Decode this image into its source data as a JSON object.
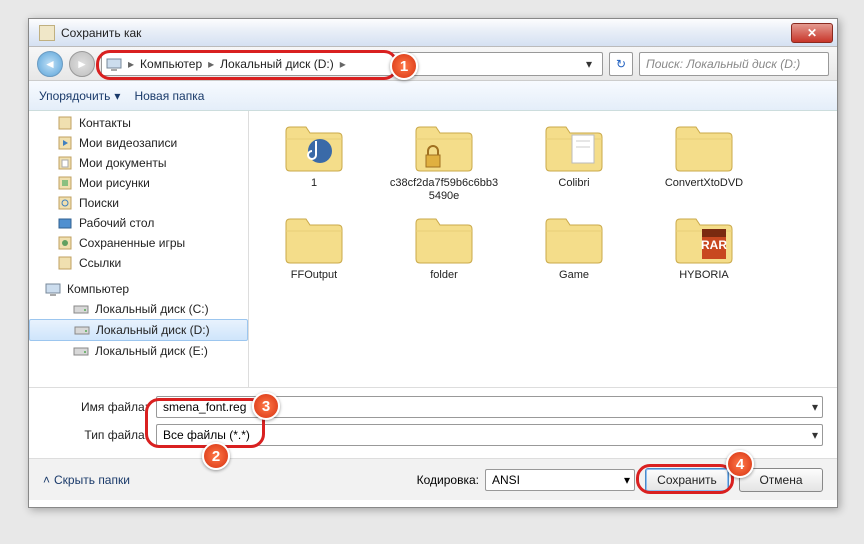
{
  "title": "Сохранить как",
  "breadcrumb": {
    "p1": "Компьютер",
    "p2": "Локальный диск (D:)"
  },
  "search_placeholder": "Поиск: Локальный диск (D:)",
  "toolbar": {
    "organize": "Упорядочить",
    "newfolder": "Новая папка"
  },
  "sidebar": {
    "items": [
      {
        "label": "Контакты"
      },
      {
        "label": "Мои видеозаписи"
      },
      {
        "label": "Мои документы"
      },
      {
        "label": "Мои рисунки"
      },
      {
        "label": "Поиски"
      },
      {
        "label": "Рабочий стол"
      },
      {
        "label": "Сохраненные игры"
      },
      {
        "label": "Ссылки"
      }
    ],
    "computer": "Компьютер",
    "drives": [
      {
        "label": "Локальный диск (C:)"
      },
      {
        "label": "Локальный диск (D:)"
      },
      {
        "label": "Локальный диск (E:)"
      }
    ]
  },
  "files": [
    {
      "label": "1",
      "variant": "music"
    },
    {
      "label": "c38cf2da7f59b6c6bb35490e",
      "variant": "lock"
    },
    {
      "label": "Colibri",
      "variant": "doc"
    },
    {
      "label": "ConvertXtoDVD",
      "variant": "plain"
    },
    {
      "label": "FFOutput",
      "variant": "plain"
    },
    {
      "label": "folder",
      "variant": "plain"
    },
    {
      "label": "Game",
      "variant": "plain"
    },
    {
      "label": "HYBORIA",
      "variant": "rar"
    }
  ],
  "filename_label": "Имя файла:",
  "filename_value": "smena_font.reg",
  "filetype_label": "Тип файла:",
  "filetype_value": "Все файлы  (*.*)",
  "hide_folders": "Скрыть папки",
  "encoding_label": "Кодировка:",
  "encoding_value": "ANSI",
  "save_btn": "Сохранить",
  "cancel_btn": "Отмена",
  "badges": {
    "b1": "1",
    "b2": "2",
    "b3": "3",
    "b4": "4"
  }
}
